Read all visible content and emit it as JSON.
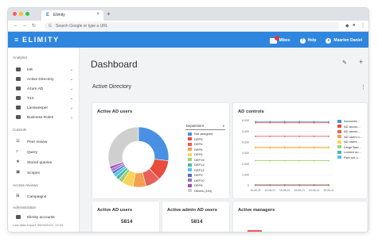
{
  "browser": {
    "tab_title": "Elimity",
    "tab_close": "×",
    "new_tab": "+",
    "address_placeholder": "Search Google or type a URL",
    "window_dots": [
      "#ff5f57",
      "#febc2e",
      "#28c840"
    ]
  },
  "app": {
    "logo": "ELIMITY",
    "brand_color": "#2e86de",
    "nav": [
      {
        "label": "Mikes",
        "icon": "flag-icon"
      },
      {
        "label": "Help",
        "icon": "help-icon"
      },
      {
        "label": "Maarten Daniel",
        "icon": "user-icon"
      }
    ]
  },
  "sidebar": {
    "sections": [
      {
        "title": "Analytics"
      },
      {
        "title": "Controls"
      },
      {
        "title": "Access reviews"
      },
      {
        "title": "Administration"
      }
    ],
    "analytics_items": [
      {
        "label": "HR",
        "icon": "folder-icon"
      },
      {
        "label": "Active Directory",
        "icon": "folder-icon"
      },
      {
        "label": "Azure AD",
        "icon": "folder-icon"
      },
      {
        "label": "T24",
        "icon": "folder-icon"
      },
      {
        "label": "Lansweeper",
        "icon": "folder-icon"
      },
      {
        "label": "Business Roles",
        "icon": "folder-icon"
      }
    ],
    "controls_items": [
      {
        "label": "Peer review",
        "icon": "list-icon"
      },
      {
        "label": "Query",
        "icon": "search-icon"
      },
      {
        "label": "Stored queries",
        "icon": "star-icon"
      },
      {
        "label": "Scopes",
        "icon": "scope-icon"
      }
    ],
    "reviews_items": [
      {
        "label": "Campaigns",
        "icon": "campaign-icon"
      }
    ],
    "admin_items": [
      {
        "label": "Elimity accounts",
        "icon": "account-icon"
      }
    ],
    "last_login": "Last data import: 05/04/2022, 13:04"
  },
  "main": {
    "title": "Dashboard",
    "section_title": "Active Directory",
    "cards": {
      "ad_users": {
        "title": "Active AD users",
        "select_value": "Department",
        "legend_col1": [
          {
            "label": "Not assigned",
            "color": "#4a90e2"
          },
          {
            "label": "DEP5",
            "color": "#e74c3c"
          },
          {
            "label": "DEP6",
            "color": "#e8605a"
          },
          {
            "label": "DEP6",
            "color": "#f5a04e"
          },
          {
            "label": "DEP5",
            "color": "#fbd35a"
          },
          {
            "label": "DEP15",
            "color": "#9fd36b"
          },
          {
            "label": "DEP14",
            "color": "#4db6ac"
          },
          {
            "label": "DEP12",
            "color": "#4fc3f7"
          },
          {
            "label": "DEP9",
            "color": "#5c6bc0"
          },
          {
            "label": "DEP10",
            "color": "#9575cd"
          },
          {
            "label": "DEP8",
            "color": "#ab47bc"
          },
          {
            "label": "Others (194)",
            "color": "#cfcfcf"
          }
        ]
      },
      "ad_controls": {
        "title": "AD controls",
        "legend": [
          {
            "label": "Accounts...",
            "color": "#4a90e2"
          },
          {
            "label": "AD accou...",
            "color": "#e74c3c"
          },
          {
            "label": "AD accou...",
            "color": "#e8605a"
          },
          {
            "label": "AD users n...",
            "color": "#f5a04e"
          },
          {
            "label": "AD users ...",
            "color": "#fbd35a"
          },
          {
            "label": "Large Bad...",
            "color": "#9fd36b"
          },
          {
            "label": "Locked ou...",
            "color": "#4db6ac"
          },
          {
            "label": "Pwd not c...",
            "color": "#4fc3f7"
          }
        ]
      },
      "active_users": {
        "title": "Active AD users",
        "value": "5814"
      },
      "active_admin": {
        "title": "Active admin AD users",
        "value": "5814"
      },
      "active_managers": {
        "title": "Active managers"
      }
    }
  },
  "chart_data": [
    {
      "type": "pie",
      "title": "Active AD users",
      "categories": [
        "Not assigned",
        "DEP5",
        "DEP6",
        "DEP6",
        "DEP5",
        "DEP15",
        "DEP14",
        "DEP12",
        "DEP9",
        "DEP10",
        "DEP8",
        "Others (194)"
      ],
      "values": [
        27,
        11,
        8,
        7,
        6,
        2.5,
        2,
        2,
        1.5,
        1.5,
        1.5,
        30
      ],
      "colors": [
        "#4a90e2",
        "#e74c3c",
        "#e8605a",
        "#f5a04e",
        "#fbd35a",
        "#9fd36b",
        "#4db6ac",
        "#4fc3f7",
        "#5c6bc0",
        "#9575cd",
        "#ab47bc",
        "#cfcfcf"
      ]
    },
    {
      "type": "line",
      "title": "AD controls",
      "x": [
        "15-06-21",
        "15-06-21",
        "15-06-21",
        "15-06-21",
        "15-06-21",
        "15-06-21"
      ],
      "yticks": [
        "0",
        "1,000",
        "2,000",
        "3,000",
        "4,000",
        "5,000",
        "6,000"
      ],
      "ylim": [
        0,
        6000
      ],
      "series": [
        {
          "name": "Accounts...",
          "values": [
            5900,
            5900,
            5900,
            5900,
            5900,
            5900
          ],
          "color": "#4a90e2"
        },
        {
          "name": "AD accou...",
          "values": [
            5800,
            5800,
            5800,
            5800,
            5800,
            5800
          ],
          "color": "#e74c3c"
        },
        {
          "name": "AD accou...",
          "values": [
            4550,
            4550,
            4550,
            4550,
            4550,
            4550
          ],
          "color": "#e8605a"
        },
        {
          "name": "AD users n...",
          "values": [
            3550,
            3550,
            3550,
            3550,
            3550,
            3550
          ],
          "color": "#f5a04e"
        },
        {
          "name": "AD users ...",
          "values": [
            3450,
            3450,
            3450,
            3450,
            3450,
            3450
          ],
          "color": "#fbd35a"
        },
        {
          "name": "Large Bad...",
          "values": [
            2300,
            2300,
            2300,
            2300,
            2300,
            2300
          ],
          "color": "#9fd36b"
        },
        {
          "name": "Locked ou...",
          "values": [
            80,
            80,
            80,
            80,
            80,
            80
          ],
          "color": "#4db6ac"
        },
        {
          "name": "Pwd not c...",
          "values": [
            30,
            30,
            30,
            30,
            30,
            30
          ],
          "color": "#e74c3c"
        }
      ]
    },
    {
      "type": "bar",
      "title": "Active managers",
      "categories": [
        ""
      ],
      "values": [
        1
      ]
    }
  ]
}
